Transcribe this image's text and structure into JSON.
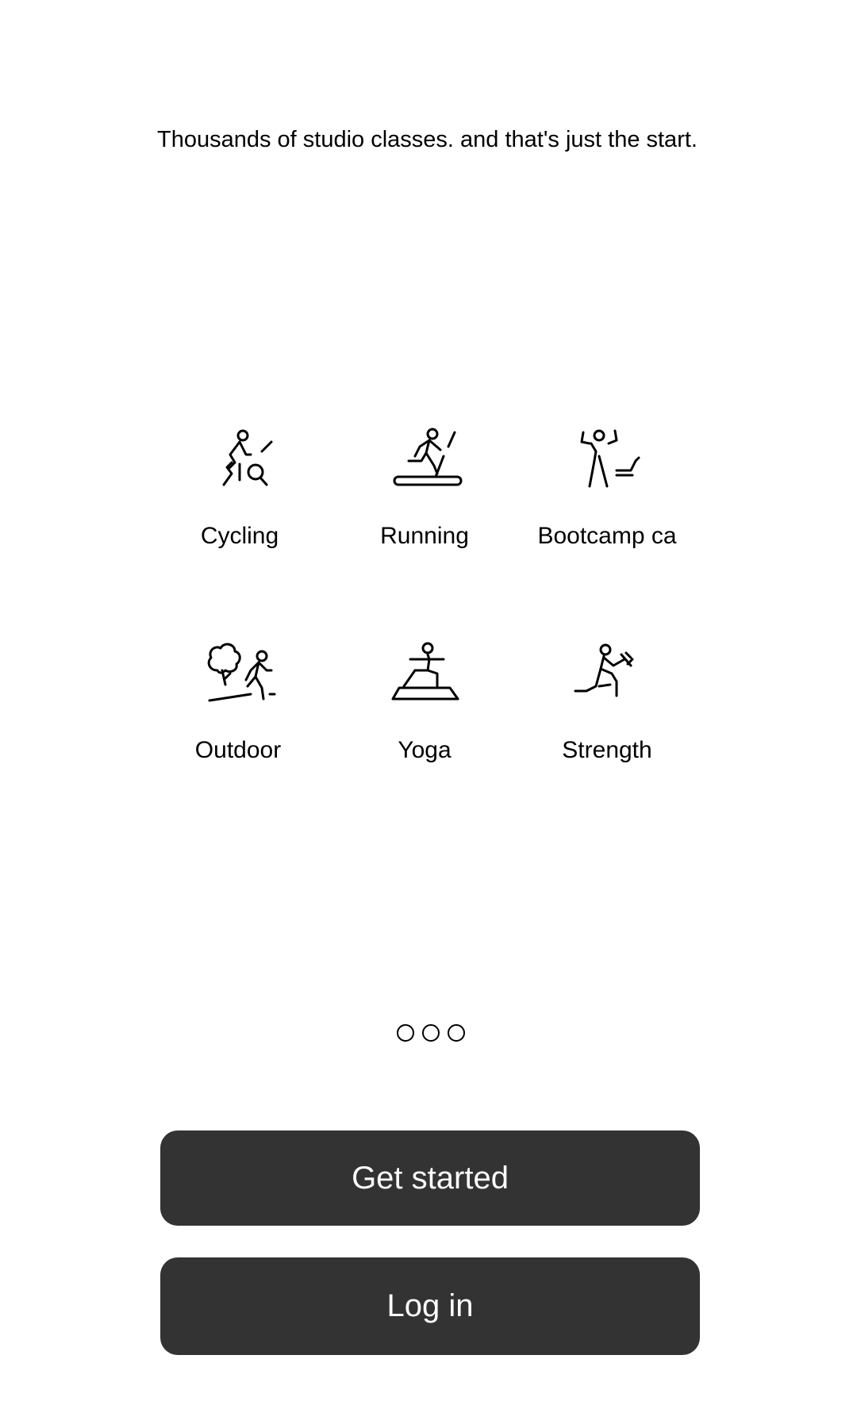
{
  "headline": "Thousands of studio classes. and that's just the start.",
  "categories": [
    {
      "label": "Cycling",
      "icon": "cycling-icon"
    },
    {
      "label": "Running",
      "icon": "running-icon"
    },
    {
      "label": "Bootcamp ca",
      "icon": "bootcamp-icon"
    },
    {
      "label": "Outdoor",
      "icon": "outdoor-icon"
    },
    {
      "label": "Yoga",
      "icon": "yoga-icon"
    },
    {
      "label": "Strength",
      "icon": "strength-icon"
    }
  ],
  "pager": {
    "count": 3
  },
  "buttons": {
    "get_started": "Get started",
    "log_in": "Log in"
  },
  "colors": {
    "button_bg": "#333333",
    "button_text": "#ffffff",
    "text": "#000000",
    "background": "#ffffff"
  }
}
